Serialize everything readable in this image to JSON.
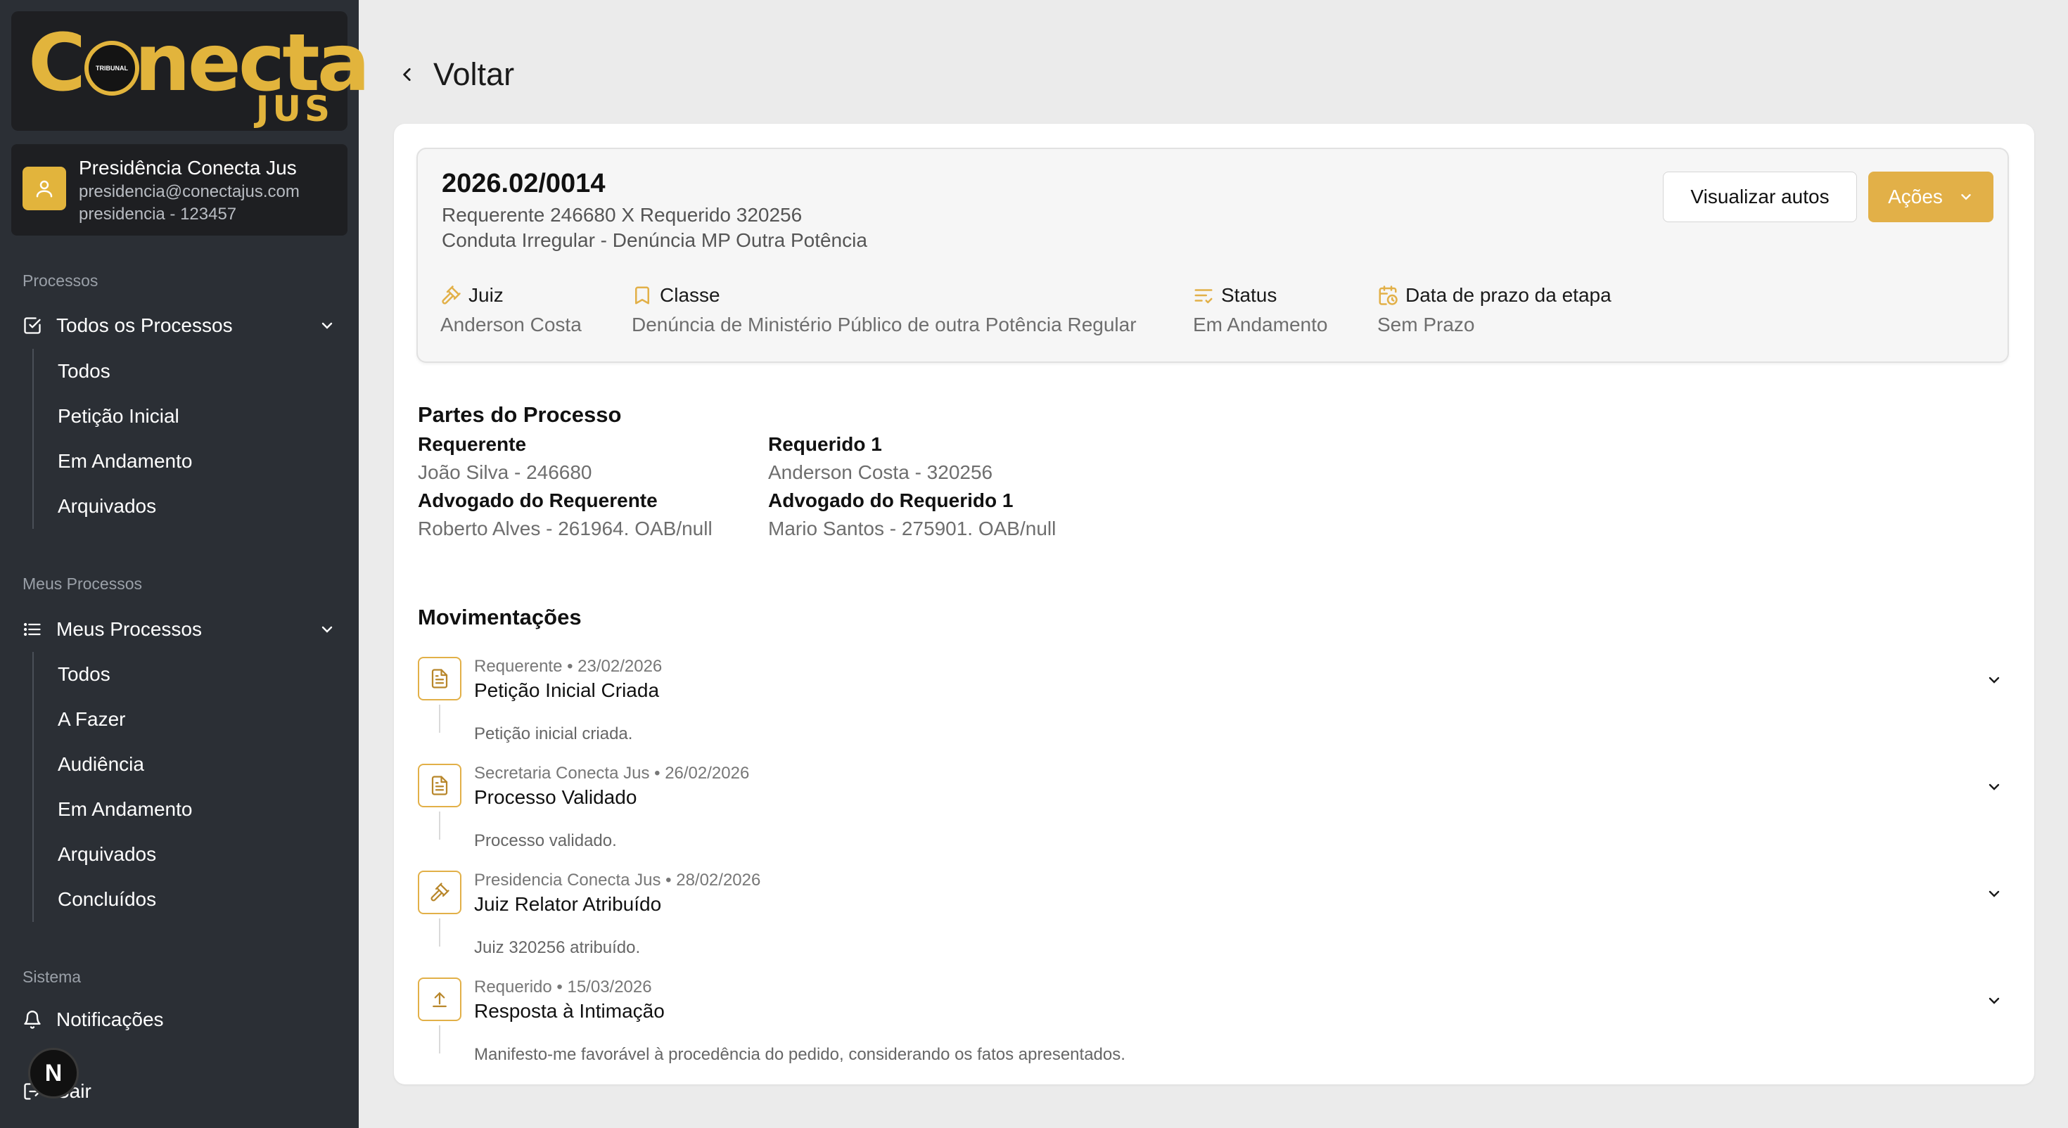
{
  "brand": {
    "logo_word": "Conecta",
    "logo_sub": "JUS",
    "seal_text": "TRIBUNAL"
  },
  "user": {
    "name": "Presidência Conecta Jus",
    "email": "presidencia@conectajus.com",
    "id": "presidencia - 123457"
  },
  "sidebar": {
    "processos_label": "Processos",
    "todos_processos": {
      "label": "Todos os Processos",
      "items": [
        "Todos",
        "Petição Inicial",
        "Em Andamento",
        "Arquivados"
      ]
    },
    "meus_label": "Meus Processos",
    "meus_processos": {
      "label": "Meus Processos",
      "items": [
        "Todos",
        "A Fazer",
        "Audiência",
        "Em Andamento",
        "Arquivados",
        "Concluídos"
      ]
    },
    "sistema_label": "Sistema",
    "notificacoes": "Notificações",
    "sair": "Sair",
    "dev_badge": "N"
  },
  "back_label": "Voltar",
  "process": {
    "number": "2026.02/0014",
    "parties_line": "Requerente 246680 X Requerido 320256",
    "subject": "Conduta Irregular - Denúncia MP Outra Potência",
    "view_button": "Visualizar autos",
    "actions_button": "Ações",
    "meta": [
      {
        "label": "Juiz",
        "value": "Anderson Costa",
        "icon": "gavel-icon"
      },
      {
        "label": "Classe",
        "value": "Denúncia de Ministério Público de outra Potência Regular",
        "icon": "bookmark-icon"
      },
      {
        "label": "Status",
        "value": "Em Andamento",
        "icon": "list-status-icon"
      },
      {
        "label": "Data de prazo da etapa",
        "value": "Sem Prazo",
        "icon": "calendar-clock-icon"
      }
    ]
  },
  "parties": {
    "title": "Partes do Processo",
    "requerente_label": "Requerente",
    "requerente_value": "João Silva - 246680",
    "adv_requerente_label": "Advogado do Requerente",
    "adv_requerente_value": "Roberto Alves - 261964. OAB/null",
    "requerido_label": "Requerido 1",
    "requerido_value": "Anderson Costa - 320256",
    "adv_requerido_label": "Advogado do Requerido 1",
    "adv_requerido_value": "Mario Santos - 275901. OAB/null"
  },
  "movements": {
    "title": "Movimentações",
    "items": [
      {
        "meta": "Requerente • 23/02/2026",
        "title": "Petição Inicial Criada",
        "desc": "Petição inicial criada.",
        "icon": "document-icon"
      },
      {
        "meta": "Secretaria Conecta Jus • 26/02/2026",
        "title": "Processo Validado",
        "desc": "Processo validado.",
        "icon": "document-icon"
      },
      {
        "meta": "Presidencia Conecta Jus • 28/02/2026",
        "title": "Juiz Relator Atribuído",
        "desc": "Juiz 320256 atribuído.",
        "icon": "gavel-icon"
      },
      {
        "meta": "Requerido • 15/03/2026",
        "title": "Resposta à Intimação",
        "desc": "Manifesto-me favorável à procedência do pedido, considerando os fatos apresentados.",
        "icon": "upload-icon"
      }
    ]
  },
  "colors": {
    "accent": "#e2b048",
    "sidebar": "#2b2f35",
    "background": "#ebebeb"
  }
}
